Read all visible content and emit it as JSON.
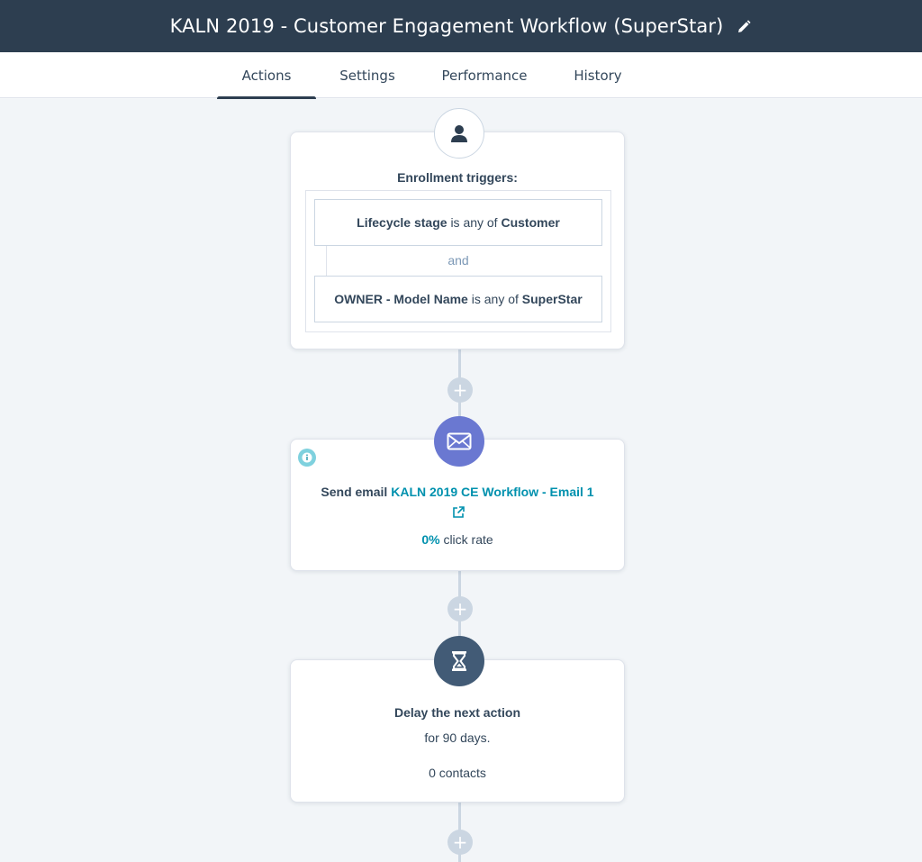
{
  "header": {
    "title": "KALN 2019 - Customer Engagement Workflow (SuperStar)",
    "edit_icon": "pencil-icon"
  },
  "tabs": [
    {
      "label": "Actions",
      "active": true
    },
    {
      "label": "Settings",
      "active": false
    },
    {
      "label": "Performance",
      "active": false
    },
    {
      "label": "History",
      "active": false
    }
  ],
  "trigger": {
    "icon": "contact-person-icon",
    "label": "Enrollment triggers:",
    "conditions": [
      {
        "property": "Lifecycle stage",
        "operator": "is any of",
        "value": "Customer"
      },
      {
        "property": "OWNER - Model Name",
        "operator": "is any of",
        "value": "SuperStar"
      }
    ],
    "joiner": "and"
  },
  "email_action": {
    "icon": "envelope-icon",
    "info_icon": "info-icon",
    "prefix": "Send email",
    "email_name": "KALN 2019 CE Workflow - Email 1",
    "external_icon": "external-link-icon",
    "rate_value": "0%",
    "rate_label": "click rate"
  },
  "delay_action": {
    "icon": "hourglass-icon",
    "title": "Delay the next action",
    "duration": "for 90 days.",
    "contacts": "0 contacts"
  },
  "add_action_icon": "plus-icon",
  "colors": {
    "header_bg": "#2d3e50",
    "email_icon_bg": "#6a78d1",
    "delay_icon_bg": "#425b76",
    "link": "#0091ae",
    "connector": "#cbd6e2"
  }
}
